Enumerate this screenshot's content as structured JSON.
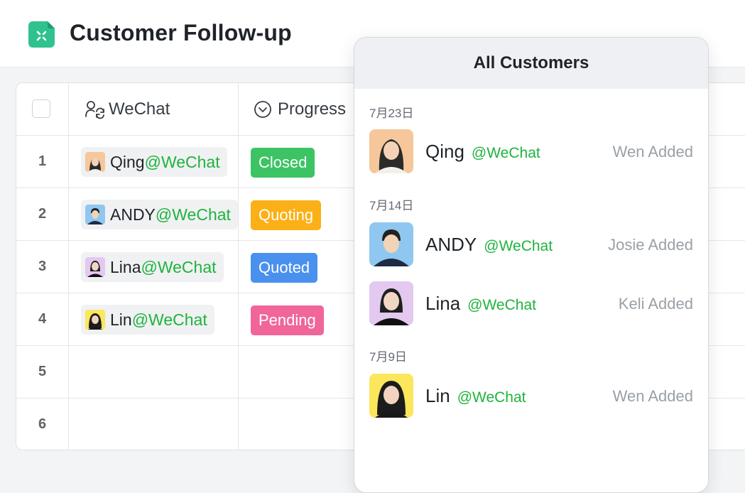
{
  "app": {
    "title": "Customer Follow-up",
    "accent": "#2fc28e"
  },
  "table": {
    "columns": [
      {
        "label": "WeChat",
        "icon": "wechat-contact-icon"
      },
      {
        "label": "Progress",
        "icon": "chevron-circle-icon"
      }
    ],
    "rows": [
      {
        "num": "1",
        "name": "Qing",
        "wechat": "@WeChat",
        "avatar_bg": "#f6c79a",
        "progress": "Closed",
        "progress_color": "#3cc464"
      },
      {
        "num": "2",
        "name": "ANDY",
        "wechat": "@WeChat",
        "avatar_bg": "#8fc7f0",
        "progress": "Quoting",
        "progress_color": "#fbb017"
      },
      {
        "num": "3",
        "name": "Lina",
        "wechat": "@WeChat",
        "avatar_bg": "#e3c8f0",
        "progress": "Quoted",
        "progress_color": "#4a90ee"
      },
      {
        "num": "4",
        "name": "Lin",
        "wechat": "@WeChat",
        "avatar_bg": "#fbe65c",
        "progress": "Pending",
        "progress_color": "#f0659a"
      },
      {
        "num": "5"
      },
      {
        "num": "6"
      }
    ]
  },
  "popup": {
    "title": "All Customers",
    "groups": [
      {
        "date": "7月23日",
        "items": [
          {
            "name": "Qing",
            "wechat": "@WeChat",
            "added": "Wen Added",
            "avatar_bg": "#f6c79a"
          }
        ]
      },
      {
        "date": "7月14日",
        "items": [
          {
            "name": "ANDY",
            "wechat": "@WeChat",
            "added": "Josie Added",
            "avatar_bg": "#8fc7f0"
          },
          {
            "name": "Lina",
            "wechat": "@WeChat",
            "added": "Keli Added",
            "avatar_bg": "#e3c8f0"
          }
        ]
      },
      {
        "date": "7月9日",
        "items": [
          {
            "name": "Lin",
            "wechat": "@WeChat",
            "added": "Wen Added",
            "avatar_bg": "#fbe65c"
          }
        ]
      }
    ]
  }
}
